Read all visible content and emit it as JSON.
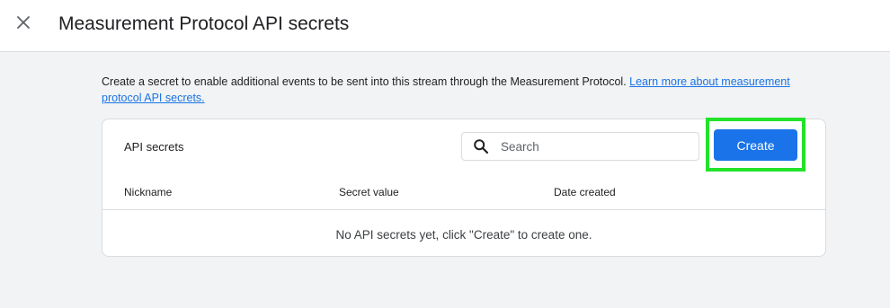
{
  "header": {
    "title": "Measurement Protocol API secrets",
    "close_icon": "close-icon"
  },
  "description": {
    "text": "Create a secret to enable additional events to be sent into this stream through the Measurement Protocol. ",
    "link_text": "Learn more about measurement protocol API secrets."
  },
  "card": {
    "title": "API secrets",
    "search": {
      "placeholder": "Search",
      "value": "",
      "icon": "search-icon"
    },
    "create_label": "Create",
    "columns": [
      "Nickname",
      "Secret value",
      "Date created"
    ],
    "rows": [],
    "empty_message": "No API secrets yet, click \"Create\" to create one."
  },
  "colors": {
    "accent": "#1a73e8",
    "highlight": "#22e22a",
    "background": "#f1f3f4"
  }
}
